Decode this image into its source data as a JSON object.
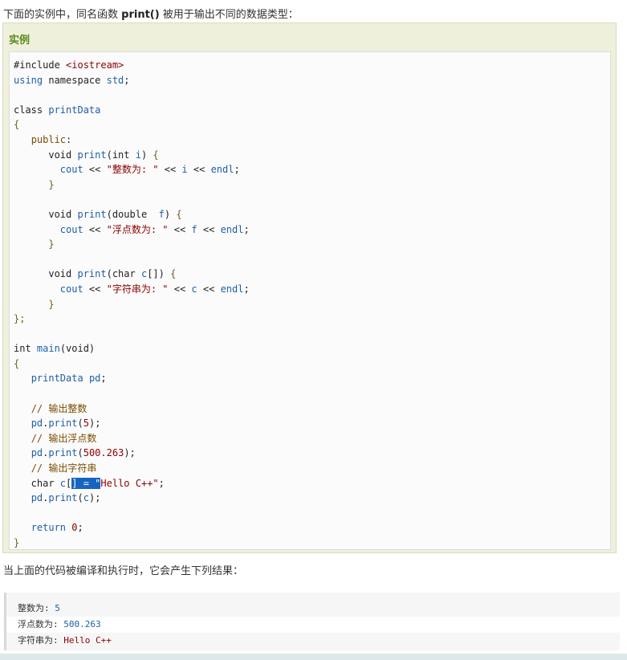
{
  "intro": {
    "prefix": "下面的实例中，同名函数 ",
    "func": "print()",
    "suffix": " 被用于输出不同的数据类型："
  },
  "example": {
    "title": "实例",
    "code_lines": [
      "#include <iostream>",
      "using namespace std;",
      "",
      "class printData",
      "{",
      "   public:",
      "      void print(int i) {",
      "        cout << \"整数为: \" << i << endl;",
      "      }",
      "",
      "      void print(double  f) {",
      "        cout << \"浮点数为: \" << f << endl;",
      "      }",
      "",
      "      void print(char c[]) {",
      "        cout << \"字符串为: \" << c << endl;",
      "      }",
      "};",
      "",
      "int main(void)",
      "{",
      "   printData pd;",
      "",
      "   // 输出整数",
      "   pd.print(5);",
      "   // 输出浮点数",
      "   pd.print(500.263);",
      "   // 输出字符串",
      "   char c[] = \"Hello C++\";",
      "   pd.print(c);",
      "",
      "   return 0;",
      "}"
    ],
    "selected_text": "] = \""
  },
  "after_text": "当上面的代码被编译和执行时，它会产生下列结果：",
  "output": [
    {
      "label": "整数为: ",
      "value": "5"
    },
    {
      "label": "浮点数为: ",
      "value": "500.263"
    },
    {
      "label": "字符串为: ",
      "value": "Hello C++"
    }
  ],
  "colors": {
    "title_green": "#5a8a1a",
    "box_bg": "#eef0db",
    "selection": "#1565c0",
    "string_red": "#8b0000",
    "type_blue": "#1f5fa8"
  }
}
